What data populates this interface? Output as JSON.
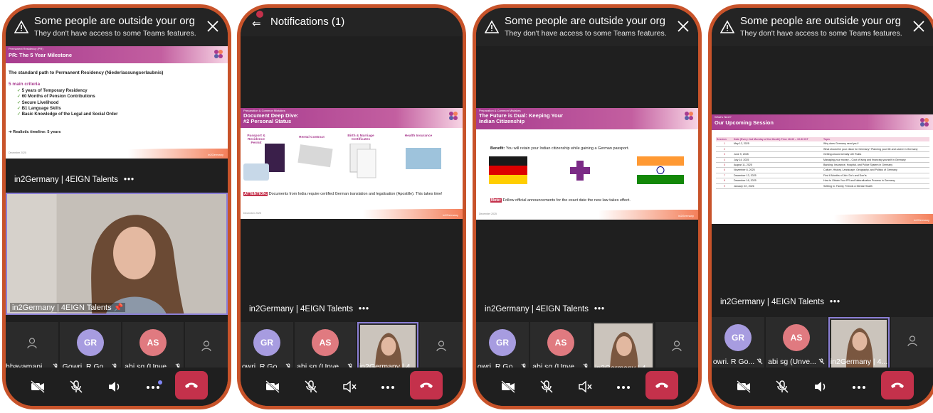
{
  "banner": {
    "title": "Some people are outside your org",
    "subtitle": "They don't have access to some Teams features."
  },
  "notifications": {
    "title": "Notifications (1)"
  },
  "shared_tile_label": "in2Germany | 4EIGN Talents",
  "more_label": "•••",
  "slides": {
    "pr": {
      "kicker": "Permanent Residency (PR)",
      "title": "PR: The 5 Year Milestone",
      "intro": "The standard path to Permanent Residency (Niederlassungserlaubnis)",
      "criteria_heading": "5 main criteria",
      "criteria": [
        "5 years of Temporary Residency",
        "60 Months of Pension Contributions",
        "Secure Livelihood",
        "B1 Language Skills",
        "Basic Knowledge of the Legal and Social Order"
      ],
      "timeline": "➔ Realistic timeline: 5 years",
      "date": "December 2025"
    },
    "docs": {
      "kicker": "Preparation & Common Mistakes",
      "title_line1": "Document Deep Dive:",
      "title_line2": "#2 Personal Status",
      "cards": [
        "Passport & Residence Permit",
        "Rental Contract",
        "Birth & Marriage Certificates",
        "Health Insurance"
      ],
      "attention_label": "ATTENTION:",
      "attention_text": "Documents from India require certified German translation and legalisation (Apostille). This takes time!",
      "date": "December 2025"
    },
    "dual": {
      "kicker": "Preparation & Common Mistakes",
      "title_line1": "The Future is Dual: Keeping Your",
      "title_line2": "Indian Citizenship",
      "benefit_label": "Benefit:",
      "benefit_text": "You will retain your Indian citizenship while gaining a German passport.",
      "note_label": "Note:",
      "note_text": "Follow official announcements for the exact date the new law takes effect.",
      "date": "December 2025"
    },
    "sessions": {
      "kicker": "What's Next?",
      "title": "Our Upcoming Session",
      "headers": [
        "Session",
        "Date (Every 2nd Monday of the Month) Time 18:30 – 19:30 IST",
        "Topic"
      ],
      "rows": [
        [
          "1",
          "May 12, 2025",
          "Why does Germany need you?"
        ],
        [
          "2",
          "",
          "What should be your vision for Germany? Planning your life and career in Germany"
        ],
        [
          "3",
          "June 9, 2025",
          "Getting Around & Daily Life Rules"
        ],
        [
          "4",
          "July 14, 2025",
          "Managing your money – Cost of living and financing yourself in Germany"
        ],
        [
          "5",
          "August 11, 2025",
          "Banking, Insurance, Hospital, and Police System in Germany"
        ],
        [
          "6",
          "November 8, 2025",
          "Culture, History, Landscape, Geography, and Politics of Germany"
        ],
        [
          "7",
          "December 13, 2025",
          "First 6 Months of Job: Do's and Don'ts"
        ],
        [
          "8",
          "December 16, 2025",
          "How to Obtain Your PR and Naturalization Process in Germany"
        ],
        [
          "9",
          "January XX, 2026",
          "Settling In: Family, Friends & Mental Health"
        ]
      ]
    },
    "brand": "in2Germany"
  },
  "participants": {
    "p1": [
      "hhavamani ...",
      "Gowri. R Go...",
      "abi sg (Unve..."
    ],
    "p2": [
      "owri. R Go...",
      "abi sg (Unve...",
      "in2Germany | 4..."
    ],
    "p3": [
      "owri. R Go...",
      "abi sg (Unve...",
      "in2Germany | 4..."
    ],
    "p4": [
      "owri. R Go...",
      "abi sg (Unve...",
      "in2Germany | 4..."
    ],
    "initials": {
      "gr": "GR",
      "as": "AS"
    }
  },
  "pinned_video_label": "in2Germany | 4EIGN Talents",
  "colors": {
    "frame": "#c8532a",
    "end_call": "#c4314b",
    "accent": "#8b7fd6",
    "slide_band": "#a83c8f"
  }
}
